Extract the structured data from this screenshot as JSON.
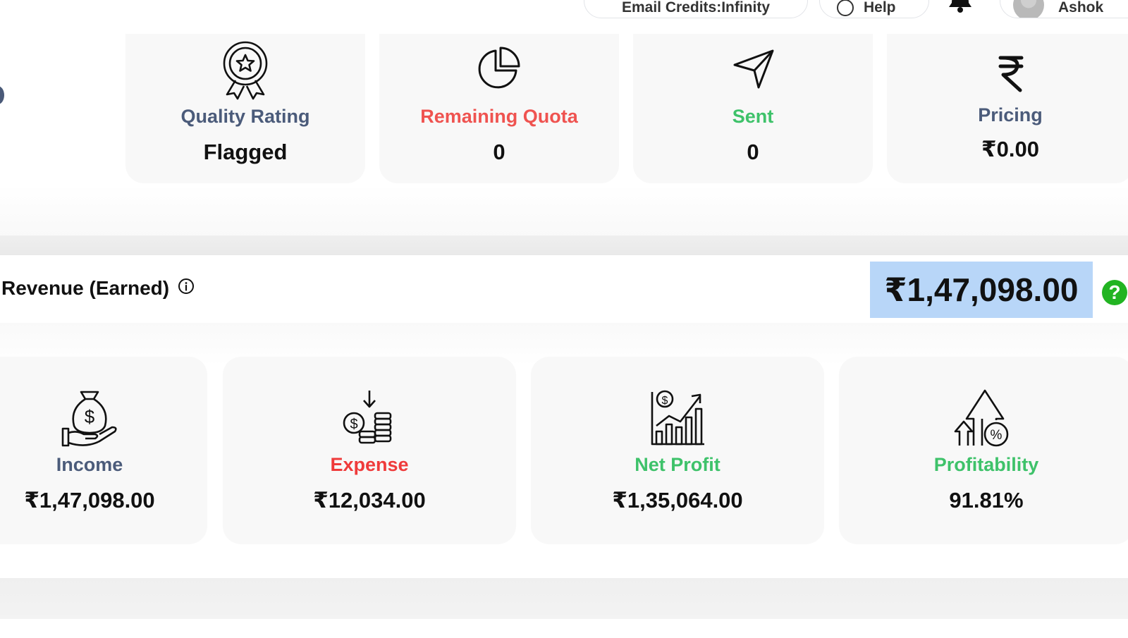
{
  "header": {
    "credits_label": "Email Credits:Infinity",
    "help_label": "Help",
    "user_name": "Ashok"
  },
  "stats": [
    {
      "label": "Quality Rating",
      "value": "Flagged",
      "color": "#4b5b7a",
      "icon": "award-ribbon-icon"
    },
    {
      "label": "Remaining Quota",
      "value": "0",
      "color": "#ef5350",
      "icon": "pie-chart-icon"
    },
    {
      "label": "Sent",
      "value": "0",
      "color": "#3ec26a",
      "icon": "paper-plane-icon"
    },
    {
      "label": "Pricing",
      "value": "₹0.00",
      "color": "#4b5b7a",
      "icon": "rupee-icon"
    }
  ],
  "revenue": {
    "title": "Revenue (Earned)",
    "amount": "₹1,47,098.00",
    "help_badge": "?"
  },
  "finance": [
    {
      "label": "Income",
      "value": "₹1,47,098.00",
      "color": "#4b5b7a",
      "icon": "money-bag-hand-icon"
    },
    {
      "label": "Expense",
      "value": "₹12,034.00",
      "color": "#ef3b3b",
      "icon": "coins-down-icon"
    },
    {
      "label": "Net Profit",
      "value": "₹1,35,064.00",
      "color": "#3ec26a",
      "icon": "growth-chart-icon"
    },
    {
      "label": "Profitability",
      "value": "91.81%",
      "color": "#3ec26a",
      "icon": "percent-up-icon"
    }
  ]
}
